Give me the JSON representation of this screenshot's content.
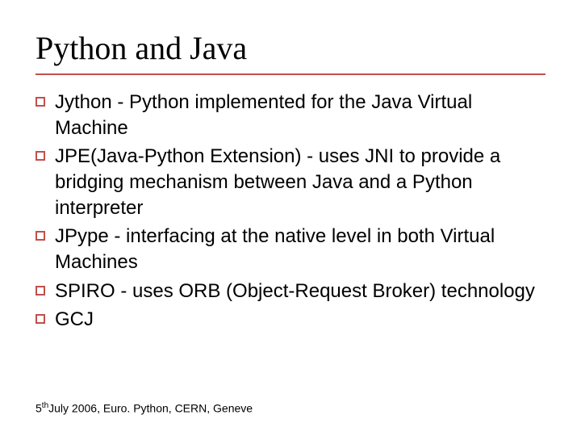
{
  "title": "Python and Java",
  "bullets": [
    "Jython - Python implemented for the Java Virtual Machine",
    "JPE(Java-Python Extension) - uses JNI to provide a bridging mechanism between Java and a Python interpreter",
    "JPype - interfacing at the native level in both Virtual Machines",
    "SPIRO - uses ORB (Object-Request Broker) technology",
    "GCJ"
  ],
  "footer": {
    "day": "5",
    "ordinal": "th",
    "rest": "July 2006, Euro. Python, CERN, Geneve"
  }
}
